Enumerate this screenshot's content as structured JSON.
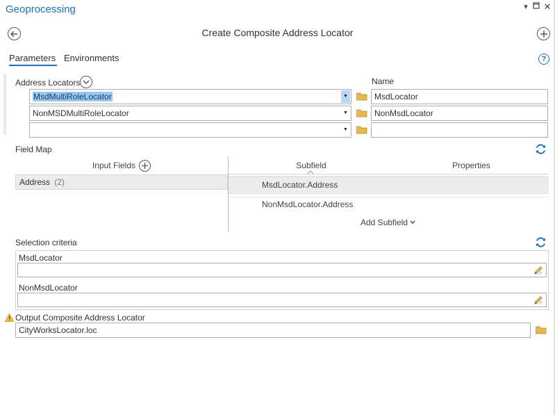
{
  "pane": {
    "title": "Geoprocessing",
    "window_controls": [
      "dropdown-icon",
      "restore-icon",
      "close-icon"
    ]
  },
  "tool": {
    "title": "Create Composite Address Locator",
    "back_icon": "back-arrow-icon",
    "add_icon": "plus-icon"
  },
  "tabs": [
    {
      "label": "Parameters",
      "active": true
    },
    {
      "label": "Environments",
      "active": false
    }
  ],
  "help_icon": "help-icon",
  "address_locators": {
    "label": "Address Locators",
    "name_label": "Name",
    "rows": [
      {
        "locator": "MsdMultiRoleLocator",
        "name": "MsdLocator",
        "selected": true
      },
      {
        "locator": "NonMSDMultiRoleLocator",
        "name": "NonMsdLocator",
        "selected": false
      },
      {
        "locator": "",
        "name": "",
        "selected": false
      }
    ]
  },
  "field_map": {
    "label": "Field Map",
    "input_fields_header": "Input Fields",
    "subfield_header": "Subfield",
    "properties_header": "Properties",
    "input_field": {
      "name": "Address",
      "count": "(2)"
    },
    "subfields": [
      "MsdLocator.Address",
      "NonMsdLocator.Address"
    ],
    "add_subfield_label": "Add Subfield"
  },
  "selection_criteria": {
    "label": "Selection criteria",
    "items": [
      {
        "name": "MsdLocator",
        "value": ""
      },
      {
        "name": "NonMsdLocator",
        "value": ""
      }
    ]
  },
  "output": {
    "label": "Output Composite Address Locator",
    "value": "CityWorksLocator.loc",
    "warning_icon": "warning-icon"
  },
  "colors": {
    "accent": "#1f70b3",
    "selection": "#99c9ef",
    "folder": "#e8b94a",
    "border": "#abadb3"
  }
}
